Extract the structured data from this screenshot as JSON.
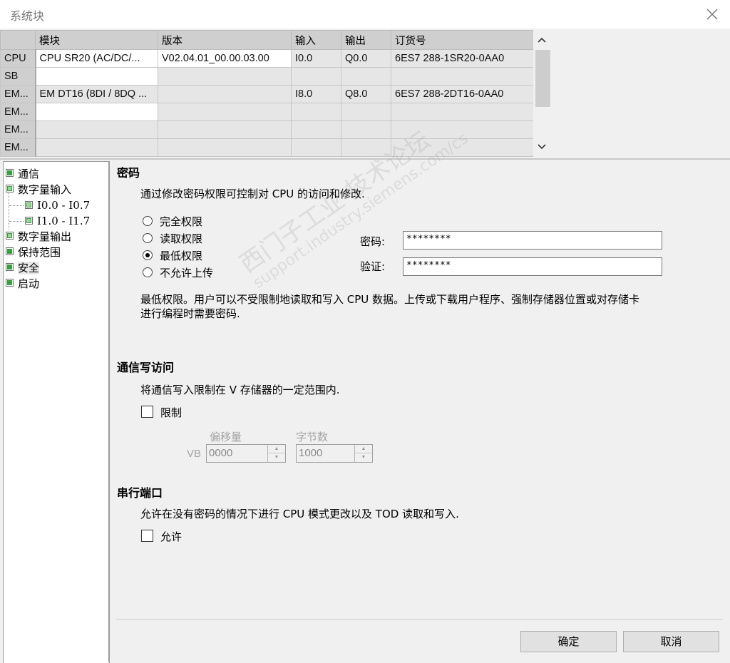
{
  "window": {
    "title": "系统块"
  },
  "module_table": {
    "columns": [
      "",
      "模块",
      "版本",
      "输入",
      "输出",
      "订货号"
    ],
    "rows": [
      {
        "head": "CPU",
        "module": "CPU SR20 (AC/DC/...",
        "version": "V02.04.01_00.00.03.00",
        "input": "I0.0",
        "output": "Q0.0",
        "order": "6ES7 288-1SR20-0AA0"
      },
      {
        "head": "SB",
        "module": "",
        "version": "",
        "input": "",
        "output": "",
        "order": ""
      },
      {
        "head": "EM...",
        "module": "EM DT16 (8DI / 8DQ ...",
        "version": "",
        "input": "I8.0",
        "output": "Q8.0",
        "order": "6ES7 288-2DT16-0AA0"
      },
      {
        "head": "EM...",
        "module": "",
        "version": "",
        "input": "",
        "output": "",
        "order": ""
      },
      {
        "head": "EM...",
        "module": "",
        "version": "",
        "input": "",
        "output": "",
        "order": ""
      },
      {
        "head": "EM...",
        "module": "",
        "version": "",
        "input": "",
        "output": "",
        "order": ""
      }
    ]
  },
  "tree": {
    "items": [
      {
        "label": "通信",
        "level": 0,
        "icon": "check"
      },
      {
        "label": "数字量输入",
        "level": 0,
        "icon": "square"
      },
      {
        "label": "I0.0 - I0.7",
        "level": 1,
        "icon": "square"
      },
      {
        "label": "I1.0 - I1.7",
        "level": 1,
        "icon": "square"
      },
      {
        "label": "数字量输出",
        "level": 0,
        "icon": "square"
      },
      {
        "label": "保持范围",
        "level": 0,
        "icon": "check"
      },
      {
        "label": "安全",
        "level": 0,
        "icon": "check",
        "selected": true
      },
      {
        "label": "启动",
        "level": 0,
        "icon": "check"
      }
    ]
  },
  "password": {
    "title": "密码",
    "description": "通过修改密码权限可控制对 CPU 的访问和修改.",
    "options": [
      "完全权限",
      "读取权限",
      "最低权限",
      "不允许上传"
    ],
    "selected": "最低权限",
    "password_label": "密码:",
    "password_value": "********",
    "verify_label": "验证:",
    "verify_value": "********",
    "explain_line1": "最低权限。用户可以不受限制地读取和写入 CPU 数据。上传或下载用户程序、强制存储器位置或对存储卡",
    "explain_line2": "进行编程时需要密码."
  },
  "comm_write": {
    "title": "通信写访问",
    "description": "将通信写入限制在 V 存储器的一定范围内.",
    "limit_label": "限制",
    "limit_checked": false,
    "vb_label": "VB",
    "offset_label": "偏移量",
    "offset_value": "0000",
    "bytes_label": "字节数",
    "bytes_value": "1000"
  },
  "serial_port": {
    "title": "串行端口",
    "description": "允许在没有密码的情况下进行 CPU 模式更改以及 TOD 读取和写入.",
    "allow_label": "允许",
    "allow_checked": false
  },
  "buttons": {
    "ok": "确定",
    "cancel": "取消"
  },
  "watermark": {
    "line1": "西门子工业 技术论坛",
    "line2": "support.industry.siemens.com/cs"
  },
  "colors": {
    "check_green": "#37a13f",
    "header_gray": "#cfcfcf"
  }
}
